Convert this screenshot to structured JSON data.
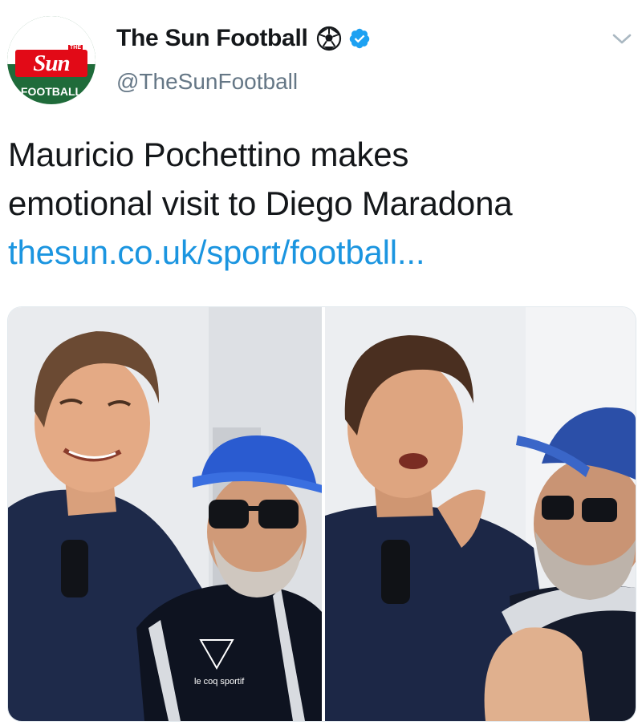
{
  "account": {
    "display_name": "The Sun Football",
    "handle": "@TheSunFootball",
    "avatar": {
      "wordmark": "Sun",
      "wordmark_prefix": "THE",
      "section": "FOOTBALL"
    },
    "name_emoji": "soccer-ball-icon",
    "verified": true
  },
  "tweet": {
    "text_line_1": "Mauricio Pochettino makes",
    "text_line_2": "emotional visit to Diego Maradona",
    "link": "thesun.co.uk/sport/football..."
  },
  "media": {
    "photos": [
      {
        "shirt_logo_text": "le coq sportif"
      },
      {}
    ]
  },
  "colors": {
    "link": "#1b95e0",
    "verified": "#1da1f2",
    "brand_red": "#e20a17",
    "brand_green": "#1f6b3a",
    "text": "#14171a",
    "secondary_text": "#657786"
  }
}
